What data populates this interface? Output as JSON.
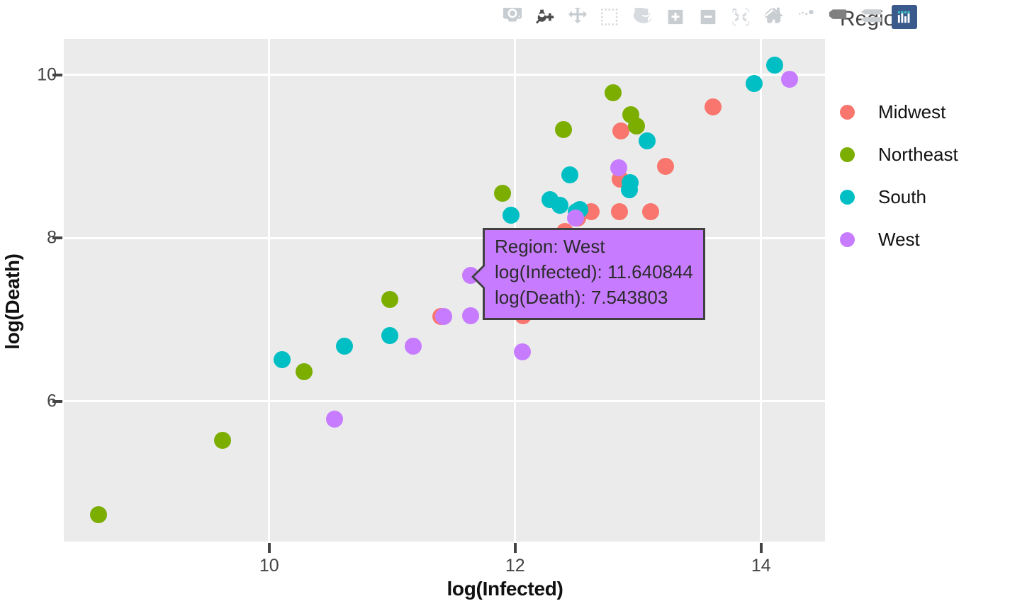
{
  "modebar": {
    "buttons": [
      {
        "name": "download-plot-icon",
        "label": "Download plot as a png",
        "state": "inactive"
      },
      {
        "name": "zoom-icon",
        "label": "Zoom",
        "state": "active"
      },
      {
        "name": "pan-icon",
        "label": "Pan",
        "state": "inactive"
      },
      {
        "name": "box-select-icon",
        "label": "Box Select",
        "state": "inactive"
      },
      {
        "name": "lasso-select-icon",
        "label": "Lasso Select",
        "state": "inactive"
      },
      {
        "name": "zoom-in-icon",
        "label": "Zoom in",
        "state": "inactive"
      },
      {
        "name": "zoom-out-icon",
        "label": "Zoom out",
        "state": "inactive"
      },
      {
        "name": "autoscale-icon",
        "label": "Autoscale",
        "state": "inactive"
      },
      {
        "name": "reset-axes-icon",
        "label": "Reset axes",
        "state": "inactive"
      },
      {
        "name": "toggle-spike-lines-icon",
        "label": "Toggle Spike Lines",
        "state": "inactive"
      },
      {
        "name": "hover-compare-icon",
        "label": "Compare data on hover",
        "state": "active"
      },
      {
        "name": "hover-closest-icon",
        "label": "Show closest data on hover",
        "state": "inactive"
      },
      {
        "name": "plotly-logo-icon",
        "label": "Produced with Plotly",
        "state": "logo"
      }
    ]
  },
  "legend": {
    "title": "Region",
    "items": [
      {
        "label": "Midwest",
        "color": "#F8766D"
      },
      {
        "label": "Northeast",
        "color": "#7CAE00"
      },
      {
        "label": "South",
        "color": "#00BFC4"
      },
      {
        "label": "West",
        "color": "#C77CFF"
      }
    ]
  },
  "tooltip": {
    "visible": true,
    "bg_color": "#C77CFF",
    "border_color": "#404040",
    "lines": [
      "Region: West",
      "log(Infected): 11.640844",
      "log(Death): 7.543803"
    ]
  },
  "chart_data": {
    "type": "scatter",
    "title": "",
    "xlabel": "log(Infected)",
    "ylabel": "log(Death)",
    "xlim": [
      8.33,
      14.52
    ],
    "ylim": [
      4.28,
      10.44
    ],
    "xticks": [
      10,
      12,
      14
    ],
    "yticks": [
      6,
      8,
      10
    ],
    "grid": true,
    "grid_color": "#FFFFFF",
    "plot_bg": "#EBEBEB",
    "paper_bg": "#FFFFFF",
    "legend_position": "right",
    "legend_title": "Region",
    "marker_size": 12,
    "series": [
      {
        "name": "Midwest",
        "color": "#F8766D",
        "points": [
          {
            "x": 11.395,
            "y": 7.043
          },
          {
            "x": 12.404,
            "y": 8.077
          },
          {
            "x": 12.618,
            "y": 8.325
          },
          {
            "x": 12.848,
            "y": 8.325
          },
          {
            "x": 12.86,
            "y": 9.308
          },
          {
            "x": 12.855,
            "y": 8.718
          },
          {
            "x": 13.105,
            "y": 8.325
          },
          {
            "x": 13.226,
            "y": 8.88
          },
          {
            "x": 13.61,
            "y": 9.607
          },
          {
            "x": 12.51,
            "y": 8.248
          },
          {
            "x": 12.062,
            "y": 7.051
          }
        ]
      },
      {
        "name": "Northeast",
        "color": "#7CAE00",
        "points": [
          {
            "x": 8.61,
            "y": 4.607
          },
          {
            "x": 9.62,
            "y": 5.521
          },
          {
            "x": 10.285,
            "y": 6.359
          },
          {
            "x": 10.98,
            "y": 7.248
          },
          {
            "x": 11.9,
            "y": 8.547
          },
          {
            "x": 12.395,
            "y": 9.333
          },
          {
            "x": 12.795,
            "y": 9.778
          },
          {
            "x": 12.94,
            "y": 9.513
          },
          {
            "x": 12.985,
            "y": 9.376
          }
        ]
      },
      {
        "name": "South",
        "color": "#00BFC4",
        "points": [
          {
            "x": 10.105,
            "y": 6.513
          },
          {
            "x": 10.61,
            "y": 6.675
          },
          {
            "x": 10.98,
            "y": 6.803
          },
          {
            "x": 11.965,
            "y": 8.282
          },
          {
            "x": 12.285,
            "y": 8.47
          },
          {
            "x": 12.365,
            "y": 8.402
          },
          {
            "x": 12.445,
            "y": 8.778
          },
          {
            "x": 12.495,
            "y": 8.325
          },
          {
            "x": 12.525,
            "y": 8.35
          },
          {
            "x": 12.93,
            "y": 8.59
          },
          {
            "x": 12.935,
            "y": 8.675
          },
          {
            "x": 13.075,
            "y": 9.188
          },
          {
            "x": 13.945,
            "y": 9.897
          },
          {
            "x": 14.11,
            "y": 10.12
          }
        ]
      },
      {
        "name": "West",
        "color": "#C77CFF",
        "points": [
          {
            "x": 10.53,
            "y": 5.778
          },
          {
            "x": 11.17,
            "y": 6.675
          },
          {
            "x": 11.42,
            "y": 7.043
          },
          {
            "x": 11.641,
            "y": 7.044
          },
          {
            "x": 11.641,
            "y": 7.544
          },
          {
            "x": 12.06,
            "y": 6.607
          },
          {
            "x": 12.49,
            "y": 8.248
          },
          {
            "x": 12.845,
            "y": 8.863
          },
          {
            "x": 14.23,
            "y": 9.948
          }
        ]
      }
    ]
  }
}
